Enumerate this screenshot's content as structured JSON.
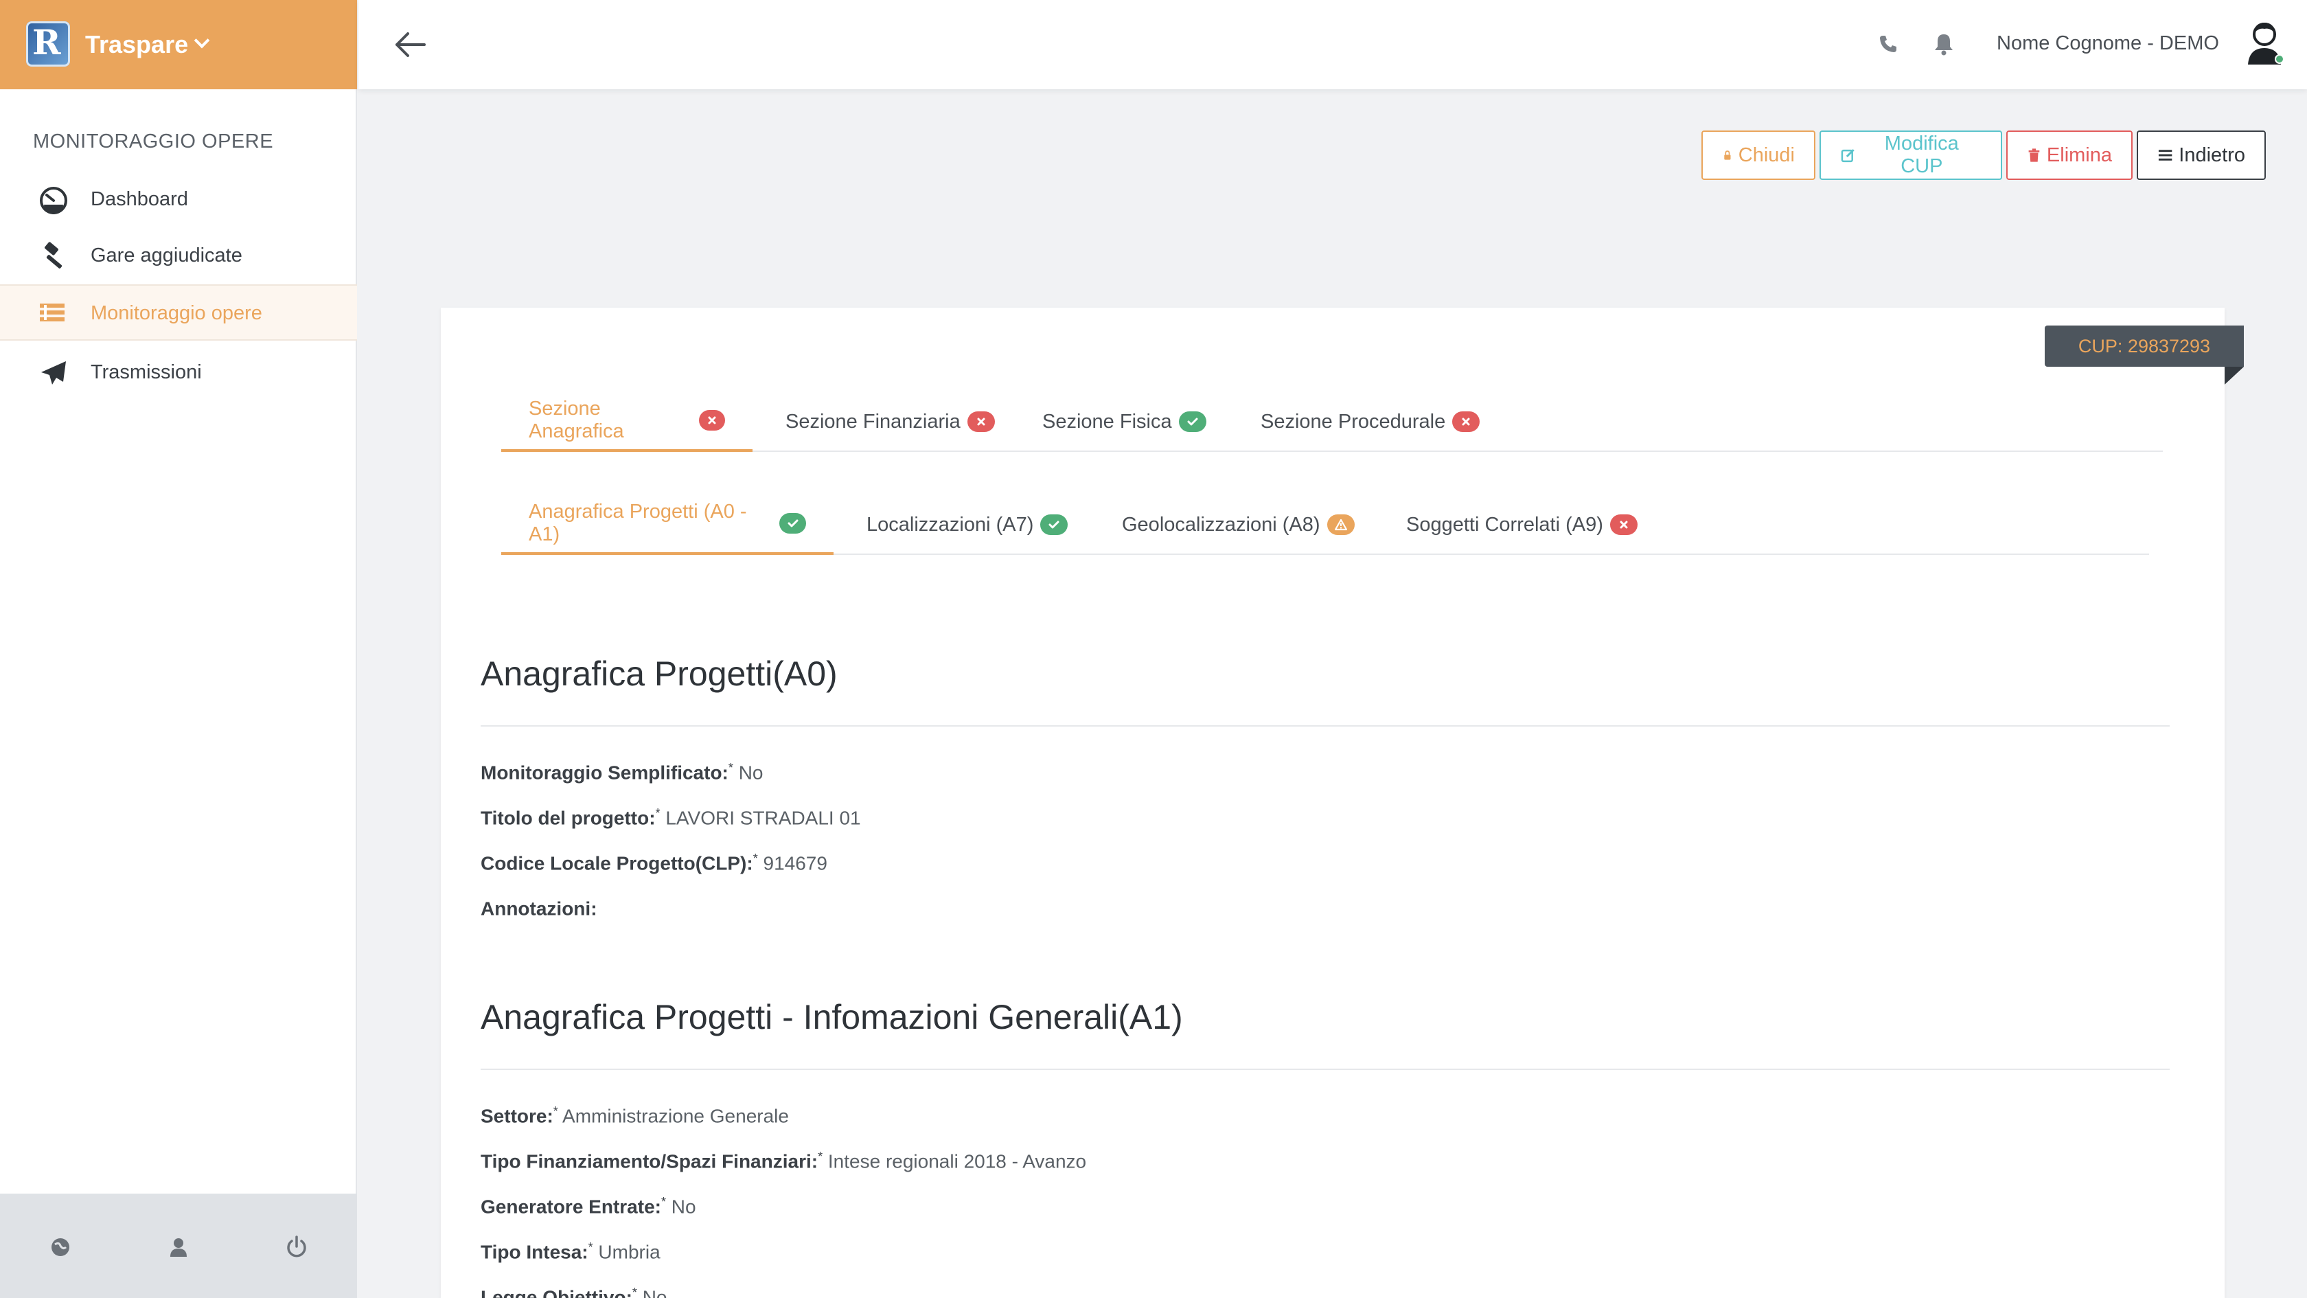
{
  "brand": {
    "name": "Traspare",
    "logo_letter": "R"
  },
  "sidebar": {
    "section_title": "MONITORAGGIO OPERE",
    "items": [
      {
        "label": "Dashboard",
        "icon": "dashboard-icon",
        "active": false
      },
      {
        "label": "Gare aggiudicate",
        "icon": "gavel-icon",
        "active": false
      },
      {
        "label": "Monitoraggio opere",
        "icon": "list-icon",
        "active": true
      },
      {
        "label": "Trasmissioni",
        "icon": "paper-plane-icon",
        "active": false
      }
    ],
    "footer_icons": [
      "globe-icon",
      "user-icon",
      "power-icon"
    ]
  },
  "header": {
    "user_name": "Nome Cognome - DEMO"
  },
  "actions": {
    "chiudi": "Chiudi",
    "modifica": "Modifica CUP",
    "elimina": "Elimina",
    "indietro": "Indietro"
  },
  "cup": "CUP: 29837293",
  "section_tabs": [
    {
      "label": "Sezione Anagrafica",
      "status": "error",
      "active": true
    },
    {
      "label": "Sezione Finanziaria",
      "status": "error",
      "active": false
    },
    {
      "label": "Sezione Fisica",
      "status": "ok",
      "active": false
    },
    {
      "label": "Sezione Procedurale",
      "status": "error",
      "active": false
    }
  ],
  "sub_tabs": [
    {
      "label": "Anagrafica Progetti (A0 - A1)",
      "status": "ok",
      "active": true
    },
    {
      "label": "Localizzazioni (A7)",
      "status": "ok",
      "active": false
    },
    {
      "label": "Geolocalizzazioni (A8)",
      "status": "warning",
      "active": false
    },
    {
      "label": "Soggetti Correlati (A9)",
      "status": "error",
      "active": false
    }
  ],
  "a0": {
    "title": "Anagrafica Progetti(A0)",
    "fields": [
      {
        "label": "Monitoraggio Semplificato:",
        "required": "*",
        "value": "No"
      },
      {
        "label": "Titolo del progetto:",
        "required": "*",
        "value": "LAVORI STRADALI 01"
      },
      {
        "label": "Codice Locale Progetto(CLP):",
        "required": "*",
        "value": "914679"
      },
      {
        "label": "Annotazioni:",
        "required": "",
        "value": ""
      }
    ]
  },
  "a1": {
    "title": "Anagrafica Progetti - Infomazioni Generali(A1)",
    "fields": [
      {
        "label": "Settore:",
        "required": "*",
        "value": "Amministrazione Generale"
      },
      {
        "label": "Tipo Finanziamento/Spazi Finanziari:",
        "required": "*",
        "value": "Intese regionali 2018 - Avanzo"
      },
      {
        "label": "Generatore Entrate:",
        "required": "*",
        "value": "No"
      },
      {
        "label": "Tipo Intesa:",
        "required": "*",
        "value": "Umbria"
      },
      {
        "label": "Legge Obiettivo:",
        "required": "*",
        "value": "No"
      }
    ]
  },
  "colors": {
    "accent": "#eaa55c",
    "error": "#e25c5c",
    "ok": "#4fae78",
    "info": "#5bc4cc"
  }
}
